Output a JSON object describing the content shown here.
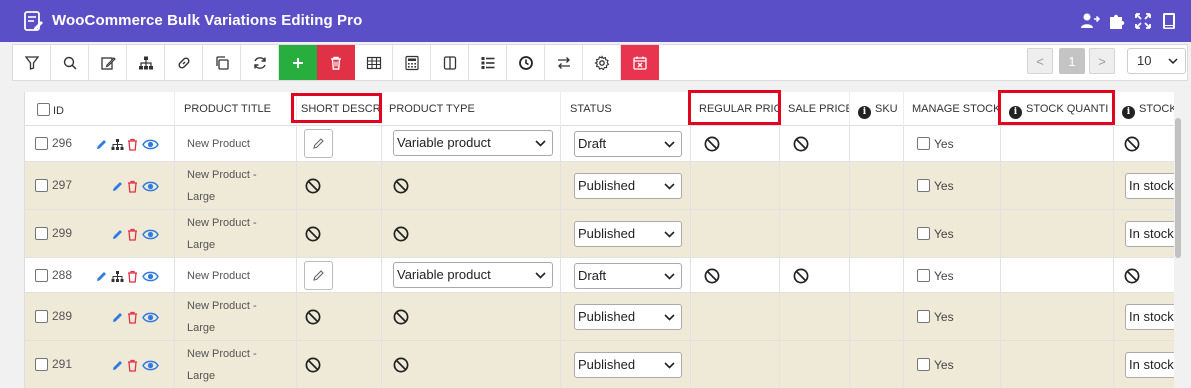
{
  "app": {
    "title": "WooCommerce Bulk Variations Editing Pro"
  },
  "icons": {
    "header": [
      "user-switch-icon",
      "puzzle-icon",
      "fullscreen-icon",
      "book-icon"
    ],
    "toolbar": [
      "filter-icon",
      "search-icon",
      "bulk-edit-icon",
      "variations-icon",
      "link-icon",
      "duplicate-icon",
      "refresh-icon",
      "add-icon",
      "delete-icon",
      "table-icon",
      "calculator-icon",
      "columns-icon",
      "list-icon",
      "history-icon",
      "import-export-icon",
      "settings-icon",
      "clear-filter-icon"
    ]
  },
  "pagination": {
    "prev": "<",
    "current": "1",
    "next": ">",
    "per_page": "10"
  },
  "columns": {
    "id": "ID",
    "product_title": "PRODUCT TITLE",
    "short_description": "SHORT DESCRI...",
    "product_type": "PRODUCT TYPE",
    "status": "STATUS",
    "regular_price": "REGULAR PRIC",
    "sale_price": "SALE PRICE",
    "sku": "SKU",
    "manage_stock": "MANAGE STOCK",
    "stock_quantity": "STOCK QUANTI",
    "stock_status": "STOCK"
  },
  "rows": [
    {
      "id": "296",
      "title_line1": "New Product",
      "title_line2": "",
      "product_type": "Variable product",
      "status": "Draft",
      "manage_stock": "Yes",
      "stock_status": ""
    },
    {
      "id": "297",
      "title_line1": "New Product -",
      "title_line2": "Large",
      "product_type": "",
      "status": "Published",
      "manage_stock": "Yes",
      "stock_status": "In stock"
    },
    {
      "id": "299",
      "title_line1": "New Product -",
      "title_line2": "Large",
      "product_type": "",
      "status": "Published",
      "manage_stock": "Yes",
      "stock_status": "In stock"
    },
    {
      "id": "288",
      "title_line1": "New Product",
      "title_line2": "",
      "product_type": "Variable product",
      "status": "Draft",
      "manage_stock": "Yes",
      "stock_status": ""
    },
    {
      "id": "289",
      "title_line1": "New Product -",
      "title_line2": "Large",
      "product_type": "",
      "status": "Published",
      "manage_stock": "Yes",
      "stock_status": "In stock"
    },
    {
      "id": "291",
      "title_line1": "New Product -",
      "title_line2": "Large",
      "product_type": "",
      "status": "Published",
      "manage_stock": "Yes",
      "stock_status": "In stock"
    }
  ],
  "colors": {
    "header": "#5b4fc8",
    "variation_row": "#efe9d7",
    "highlight": "#e0061f",
    "add": "#27ae3f",
    "delete": "#e03146"
  }
}
